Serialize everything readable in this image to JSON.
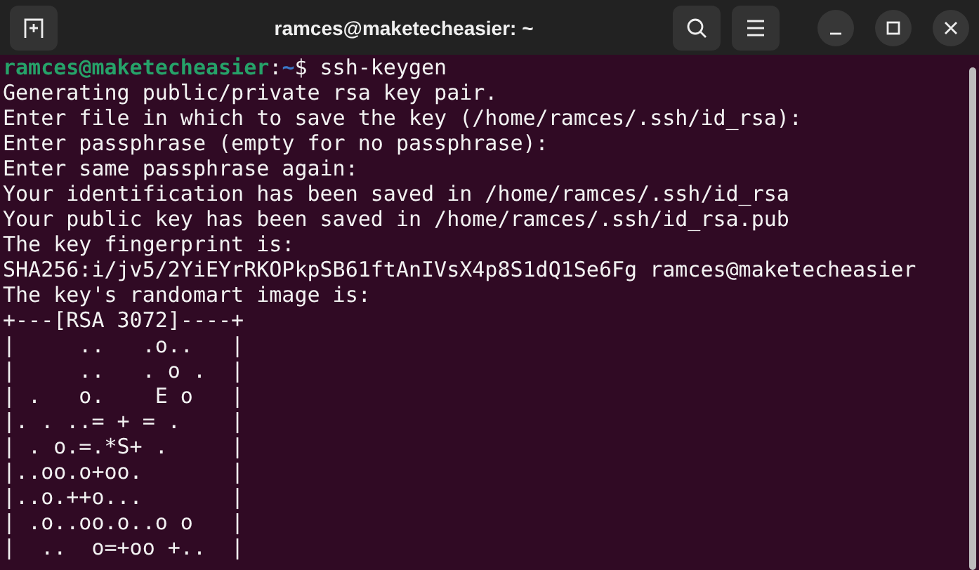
{
  "window": {
    "title": "ramces@maketecheasier: ~"
  },
  "terminal": {
    "prompt": {
      "user_host": "ramces@maketecheasier",
      "separator": ":",
      "path": "~",
      "symbol": "$",
      "command": "ssh-keygen"
    },
    "output": [
      "Generating public/private rsa key pair.",
      "Enter file in which to save the key (/home/ramces/.ssh/id_rsa):",
      "Enter passphrase (empty for no passphrase):",
      "Enter same passphrase again:",
      "Your identification has been saved in /home/ramces/.ssh/id_rsa",
      "Your public key has been saved in /home/ramces/.ssh/id_rsa.pub",
      "The key fingerprint is:",
      "SHA256:i/jv5/2YiEYrRKOPkpSB61ftAnIVsX4p8S1dQ1Se6Fg ramces@maketecheasier",
      "The key's randomart image is:",
      "+---[RSA 3072]----+",
      "|     ..   .o..   |",
      "|     ..   . o .  |",
      "| .   o.    E o   |",
      "|. . ..= + = .    |",
      "| . o.=.*S+ .     |",
      "|..oo.o+oo.       |",
      "|..o.++o...       |",
      "| .o..oo.o..o o   |",
      "|  ..  o=+oo +..  |"
    ]
  }
}
